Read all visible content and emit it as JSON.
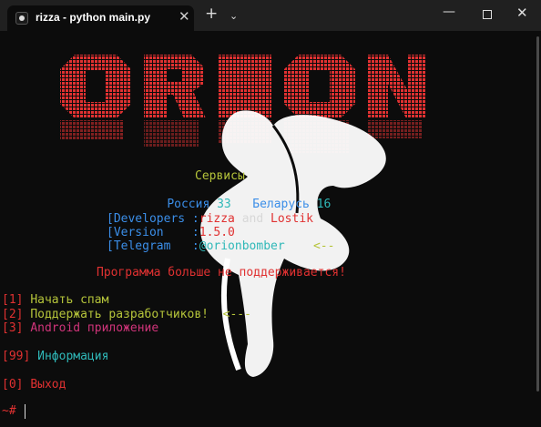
{
  "window": {
    "tab_title": "rizza - python  main.py",
    "tab_close": "✕",
    "new_tab": "+",
    "tab_dropdown": "⌄",
    "minimize": "—",
    "close": "✕"
  },
  "banner": {
    "text": "ORION",
    "color": "#e03131"
  },
  "services": {
    "title": "Сервисы",
    "russia_label": "Россия",
    "russia_count": "33",
    "belarus_label": "Беларусь",
    "belarus_count": "16"
  },
  "info": {
    "developers_key": "[Developers :",
    "developers_a": "rizza",
    "developers_and": " and ",
    "developers_b": "Lostik",
    "version_key": "[Version    :",
    "version_val": "1.5.0",
    "telegram_key": "[Telegram   :",
    "telegram_val": "@orionbomber",
    "telegram_arrow": "<--"
  },
  "notice": "Программа больше не поддерживается!",
  "menu": [
    {
      "num": "[1]",
      "label": "Начать спам"
    },
    {
      "num": "[2]",
      "label": "Поддержать разработчиков!",
      "arrow": "<---"
    },
    {
      "num": "[3]",
      "label": "Android приложение"
    },
    {
      "num": "[99]",
      "label": "Информация"
    },
    {
      "num": "[0]",
      "label": "Выход"
    }
  ],
  "prompt": "~#"
}
